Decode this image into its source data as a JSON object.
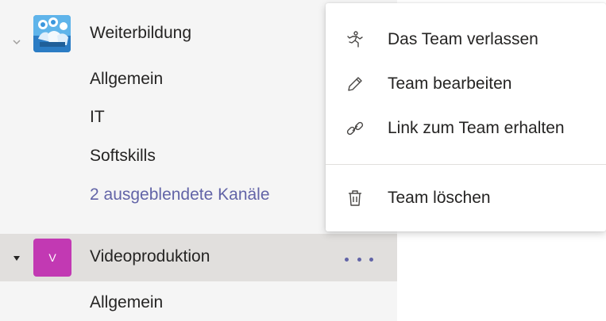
{
  "teams": [
    {
      "name": "Weiterbildung",
      "avatar_icon": "people-meeting-icon",
      "avatar_color": "#3a96dd",
      "expanded": true,
      "channels": [
        "Allgemein",
        "IT",
        "Softskills"
      ],
      "hidden_channels_label": "2 ausgeblendete Kanäle"
    },
    {
      "name": "Videoproduktion",
      "avatar_letter": "V",
      "avatar_color": "#c239b3",
      "expanded": true,
      "active": true,
      "channels": [
        "Allgemein"
      ]
    }
  ],
  "context_menu": {
    "items": [
      {
        "label": "Das Team verlassen",
        "icon": "leave-team-icon"
      },
      {
        "label": "Team bearbeiten",
        "icon": "pencil-icon"
      },
      {
        "label": "Link zum Team erhalten",
        "icon": "link-icon"
      },
      {
        "label": "Team löschen",
        "icon": "trash-icon"
      }
    ]
  },
  "colors": {
    "accent": "#6264a7",
    "active_row": "#e1dfdd",
    "pane_bg": "#f5f5f5"
  }
}
